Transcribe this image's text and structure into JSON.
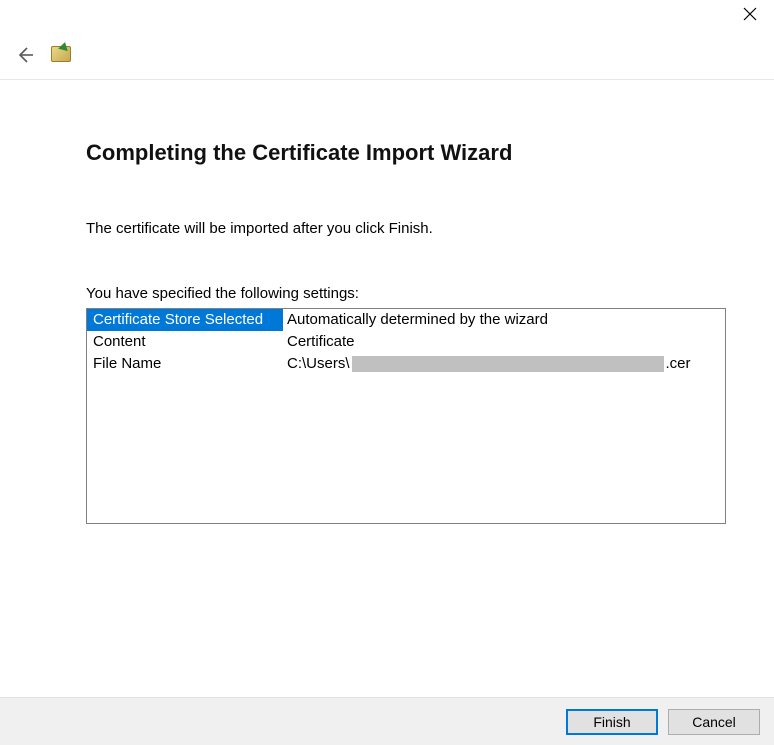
{
  "heading": "Completing the Certificate Import Wizard",
  "intro": "The certificate will be imported after you click Finish.",
  "settings_label": "You have specified the following settings:",
  "settings": {
    "rows": [
      {
        "key": "Certificate Store Selected",
        "value": "Automatically determined by the wizard",
        "selected": true
      },
      {
        "key": "Content",
        "value": "Certificate"
      },
      {
        "key": "File Name",
        "value_prefix": "C:\\Users\\",
        "value_suffix": ".cer",
        "redacted_width": 312
      }
    ]
  },
  "buttons": {
    "finish": "Finish",
    "cancel": "Cancel"
  }
}
